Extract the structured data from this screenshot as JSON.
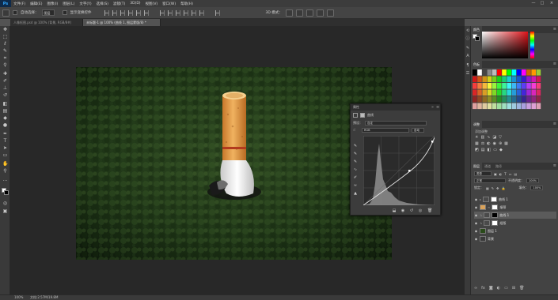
{
  "menubar": {
    "logo": "Ps",
    "items": [
      "文件(F)",
      "编辑(E)",
      "图像(I)",
      "图层(L)",
      "文字(Y)",
      "选择(S)",
      "滤镜(T)",
      "3D(D)",
      "视图(V)",
      "窗口(W)",
      "帮助(H)"
    ],
    "window_controls": [
      "—",
      "□",
      "×"
    ]
  },
  "options": {
    "auto_select_label": "自动选择：",
    "auto_select_value": "图层",
    "show_transform_label": "显示变换控件",
    "mode_3d_label": "3D 模式："
  },
  "tabs": [
    {
      "label": "人像抠图.psd @ 100% (背景, RGB/8#)",
      "active": false
    },
    {
      "label": "未标题-1 @ 100% (曲线 1, 图层蒙版/8) *",
      "active": true
    }
  ],
  "curves": {
    "title": "属性",
    "section": "曲线",
    "preset_label": "预设：",
    "preset_value": "自定",
    "channel_value": "RGB",
    "auto_label": "自动"
  },
  "panels": {
    "color_tabs": [
      "颜色"
    ],
    "swatches_tab": "色板",
    "adjustments_tab": "调整",
    "adjustments_hint": "添加调整",
    "layers_tabs": [
      "图层",
      "通道",
      "路径"
    ],
    "kind_label": "类型",
    "blend_mode": "正常",
    "opacity_label": "不透明度：",
    "opacity_value": "100%",
    "lock_label": "锁定：",
    "fill_label": "填充：",
    "fill_value": "100%",
    "layers": [
      {
        "name": "曲线 1",
        "selected": false
      },
      {
        "name": "烟蒂",
        "selected": false
      },
      {
        "name": "曲线 1",
        "selected": true
      },
      {
        "name": "组版",
        "selected": false
      },
      {
        "name": "图层 1",
        "selected": false
      },
      {
        "name": "背景",
        "selected": false
      }
    ]
  },
  "status": {
    "zoom": "100%",
    "doc_info": "文档:2.57M/19.8M"
  },
  "colors": {
    "accent": "#31a8ff",
    "canvas_bg": "#282828",
    "panel_bg": "#434343"
  }
}
